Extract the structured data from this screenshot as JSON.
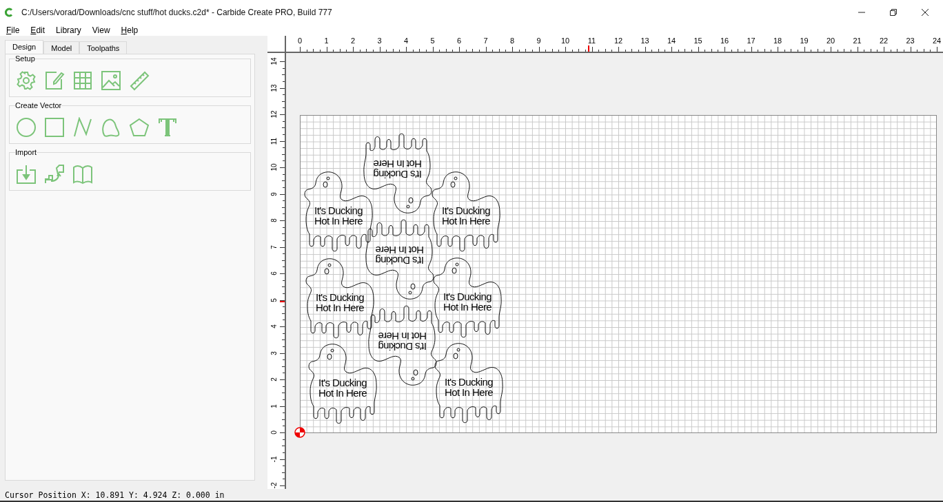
{
  "window": {
    "title": "C:/Users/vorad/Downloads/cnc stuff/hot ducks.c2d* - Carbide Create PRO, Build 777"
  },
  "menu": [
    {
      "label": "File",
      "underlined": true
    },
    {
      "label": "Edit",
      "underlined": true
    },
    {
      "label": "Library",
      "underlined": false
    },
    {
      "label": "View",
      "underlined": false
    },
    {
      "label": "Help",
      "underlined": true
    }
  ],
  "tabs": [
    {
      "label": "Design",
      "selected": true
    },
    {
      "label": "Model",
      "selected": false
    },
    {
      "label": "Toolpaths",
      "selected": false
    }
  ],
  "groups": [
    {
      "title": "Setup",
      "tools": [
        {
          "kind": "gear"
        },
        {
          "kind": "edit"
        },
        {
          "kind": "grid"
        },
        {
          "kind": "image"
        },
        {
          "kind": "ruler"
        }
      ]
    },
    {
      "title": "Create Vector",
      "tools": [
        {
          "kind": "circle"
        },
        {
          "kind": "rectangle"
        },
        {
          "kind": "polyline"
        },
        {
          "kind": "curve"
        },
        {
          "kind": "polygon"
        },
        {
          "kind": "text"
        }
      ]
    },
    {
      "title": "Import",
      "tools": [
        {
          "kind": "import"
        },
        {
          "kind": "steps"
        },
        {
          "kind": "book"
        }
      ]
    }
  ],
  "ruler": {
    "x_labels": [
      "0",
      "1",
      "2",
      "3",
      "4",
      "5",
      "6",
      "7",
      "8",
      "9",
      "10",
      "11",
      "12",
      "13",
      "14",
      "15",
      "16",
      "17",
      "18",
      "19",
      "20",
      "21",
      "22",
      "23",
      "24"
    ],
    "y_labels": [
      "14",
      "13",
      "12",
      "11",
      "10",
      "9",
      "8",
      "7",
      "6",
      "5",
      "4",
      "3",
      "2",
      "1",
      "0",
      "-1",
      "-2"
    ]
  },
  "designs": [
    {
      "flipped": true,
      "lines": [
        "It's Ducking",
        "Hot In Here"
      ]
    },
    {
      "flipped": false,
      "lines": [
        "It's Ducking",
        "Hot In Here"
      ]
    },
    {
      "flipped": false,
      "lines": [
        "It's Ducking",
        "Hot In Here"
      ]
    },
    {
      "flipped": true,
      "lines": [
        "It's Ducking",
        "Hot In Here"
      ]
    },
    {
      "flipped": false,
      "lines": [
        "It's Ducking",
        "Hot In Here"
      ]
    },
    {
      "flipped": false,
      "lines": [
        "It's Ducking",
        "Hot In Here"
      ]
    },
    {
      "flipped": true,
      "lines": [
        "It's Ducking",
        "Hot In Here"
      ]
    },
    {
      "flipped": false,
      "lines": [
        "It's Ducking",
        "Hot In Here"
      ]
    },
    {
      "flipped": false,
      "lines": [
        "It's Ducking",
        "Hot In Here"
      ]
    }
  ],
  "status_bar": {
    "text": "Cursor Position X: 10.891 Y: 4.924 Z: 0.000 in"
  }
}
